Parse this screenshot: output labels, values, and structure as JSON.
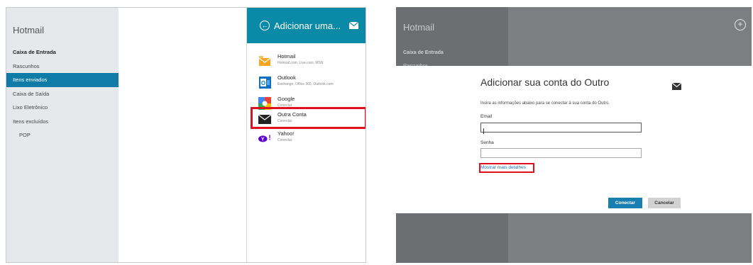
{
  "left": {
    "app_title": "Hotmail",
    "folders": [
      {
        "label": "Caixa de Entrada",
        "state": "bold"
      },
      {
        "label": "Rascunhos",
        "state": ""
      },
      {
        "label": "Itens enviados",
        "state": "selected"
      },
      {
        "label": "Caixa de Saída",
        "state": ""
      },
      {
        "label": "Lixo Eletrônico",
        "state": ""
      },
      {
        "label": "Itens excluídos",
        "state": ""
      },
      {
        "label": "POP",
        "state": "indent"
      }
    ],
    "flyout": {
      "title": "Adicionar uma...",
      "back_icon": "back-arrow-icon",
      "header_icon": "mail-icon",
      "accounts": [
        {
          "name": "Hotmail",
          "desc": "Hotmail.com, Live.com, MSN",
          "icon": "hotmail-icon",
          "color": "#f5a623"
        },
        {
          "name": "Outlook",
          "desc": "Exchange, Office 365, Outlook.com",
          "icon": "outlook-icon",
          "color": "#0a72c6"
        },
        {
          "name": "Google",
          "desc": "Conectar",
          "icon": "google-icon",
          "color": "#4285f4"
        },
        {
          "name": "Outra Conta",
          "desc": "Conectar",
          "icon": "envelope-icon",
          "color": "#222222"
        },
        {
          "name": "Yahoo!",
          "desc": "Conectar",
          "icon": "yahoo-icon",
          "color": "#5f01d1"
        }
      ]
    }
  },
  "right": {
    "app_title": "Hotmail",
    "folders": [
      "Caixa de Entrada",
      "Rascunhos"
    ],
    "add_icon": "plus-circle-icon",
    "dialog": {
      "title": "Adicionar sua conta do Outro",
      "icon": "mail-icon",
      "instructions": "Insira as informações abaixo para se conectar à sua conta do Outro.",
      "email_label": "Email",
      "email_value": "",
      "password_label": "Senha",
      "password_value": "",
      "more_details": "Mostrar mais detalhes",
      "connect": "Conectar",
      "cancel": "Cancelar"
    }
  },
  "colors": {
    "accent": "#0a8aa6",
    "selection": "#0e7ca6",
    "highlight": "#e0101c",
    "connect_button": "#1a7fb0"
  }
}
